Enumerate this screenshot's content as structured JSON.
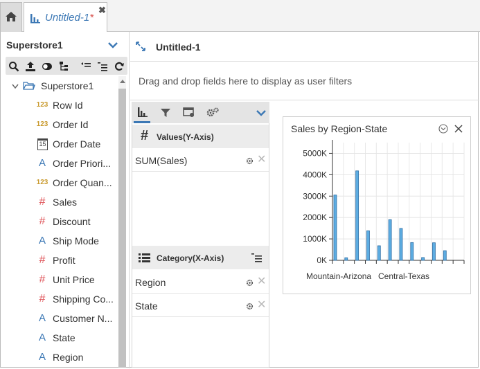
{
  "tabs": {
    "home_icon": "home-icon",
    "document": {
      "title": "Untitled-1",
      "modified_marker": "*",
      "close_glyph": "✖"
    }
  },
  "datasource": {
    "title": "Superstore1",
    "tree_root": "Superstore1",
    "fields": [
      {
        "label": "Row Id",
        "type": "numeric",
        "icon": "123-icon"
      },
      {
        "label": "Order Id",
        "type": "numeric",
        "icon": "123-icon"
      },
      {
        "label": "Order Date",
        "type": "date",
        "icon": "calendar-icon"
      },
      {
        "label": "Order Priori...",
        "type": "text",
        "icon": "text-a-icon"
      },
      {
        "label": "Order Quan...",
        "type": "numeric",
        "icon": "123-icon"
      },
      {
        "label": "Sales",
        "type": "measure",
        "icon": "hash-icon"
      },
      {
        "label": "Discount",
        "type": "measure",
        "icon": "hash-icon"
      },
      {
        "label": "Ship Mode",
        "type": "text",
        "icon": "text-a-icon"
      },
      {
        "label": "Profit",
        "type": "measure",
        "icon": "hash-icon"
      },
      {
        "label": "Unit Price",
        "type": "measure",
        "icon": "hash-icon"
      },
      {
        "label": "Shipping Co...",
        "type": "measure",
        "icon": "hash-icon"
      },
      {
        "label": "Customer N...",
        "type": "text",
        "icon": "text-a-icon"
      },
      {
        "label": "State",
        "type": "text",
        "icon": "text-a-icon"
      },
      {
        "label": "Region",
        "type": "text",
        "icon": "text-a-icon"
      }
    ],
    "icon_glyphs": {
      "numeric": "123",
      "date": "15",
      "text": "A",
      "measure": "#"
    }
  },
  "view": {
    "title": "Untitled-1",
    "filter_hint": "Drag and drop fields here to display as user filters"
  },
  "bindings": {
    "values_header": "Values(Y-Axis)",
    "values_hash": "#",
    "values": [
      {
        "label": "SUM(Sales)"
      }
    ],
    "category_header": "Category(X-Axis)",
    "category": [
      {
        "label": "Region"
      },
      {
        "label": "State"
      }
    ]
  },
  "colors": {
    "accent": "#3c78b5",
    "numeric_icon": "#c99a2e",
    "measure_icon": "#e0585d",
    "text_icon": "#3c78b5",
    "bar_fill": "#5dade2",
    "bar_stroke": "#2e6da4"
  },
  "chart_data": {
    "type": "bar",
    "title": "Sales by Region-State",
    "categories": [
      "Mountain-Arizona",
      "",
      "",
      "",
      "",
      "Central-Texas",
      "",
      "",
      "",
      "",
      "",
      ""
    ],
    "values": [
      3050,
      120,
      4180,
      1380,
      680,
      1900,
      1490,
      830,
      130,
      820,
      450
    ],
    "yticks": [
      0,
      1000,
      2000,
      3000,
      4000,
      5000
    ],
    "ytick_labels": [
      "0K",
      "1000K",
      "2000K",
      "3000K",
      "4000K",
      "5000K"
    ],
    "xtick_labels": [
      "Mountain-Arizona",
      "Central-Texas"
    ],
    "ylim": [
      0,
      5500
    ],
    "grid": true,
    "xlabel": "",
    "ylabel": ""
  }
}
